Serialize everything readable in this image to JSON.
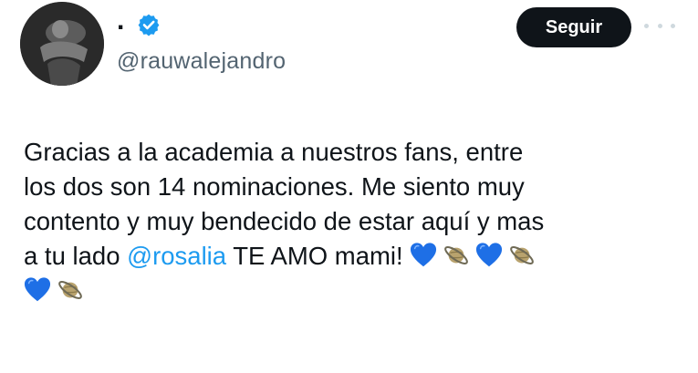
{
  "user": {
    "display_name": ".",
    "handle": "@rauwalejandro",
    "verified": true,
    "badge_color": "#1d9bf0"
  },
  "actions": {
    "follow_label": "Seguir",
    "more_icon": "more-horizontal-icon"
  },
  "tweet": {
    "line1": "Gracias a la academia a nuestros fans, entre",
    "line2": "los dos son 14 nominaciones. Me siento muy",
    "line3": "contento y muy bendecido de estar aquí y mas",
    "line4_before": "a tu lado ",
    "mention": "@rosalia",
    "line4_after": " TE AMO mami!",
    "emojis": [
      "blue-heart-icon",
      "ringed-planet-icon",
      "blue-heart-icon",
      "ringed-planet-icon",
      "blue-heart-icon",
      "ringed-planet-icon"
    ]
  },
  "colors": {
    "text": "#0f1419",
    "secondary": "#536471",
    "mention": "#1d9bf0",
    "button_bg": "#0f1419",
    "heart": "#1e6fe6"
  }
}
